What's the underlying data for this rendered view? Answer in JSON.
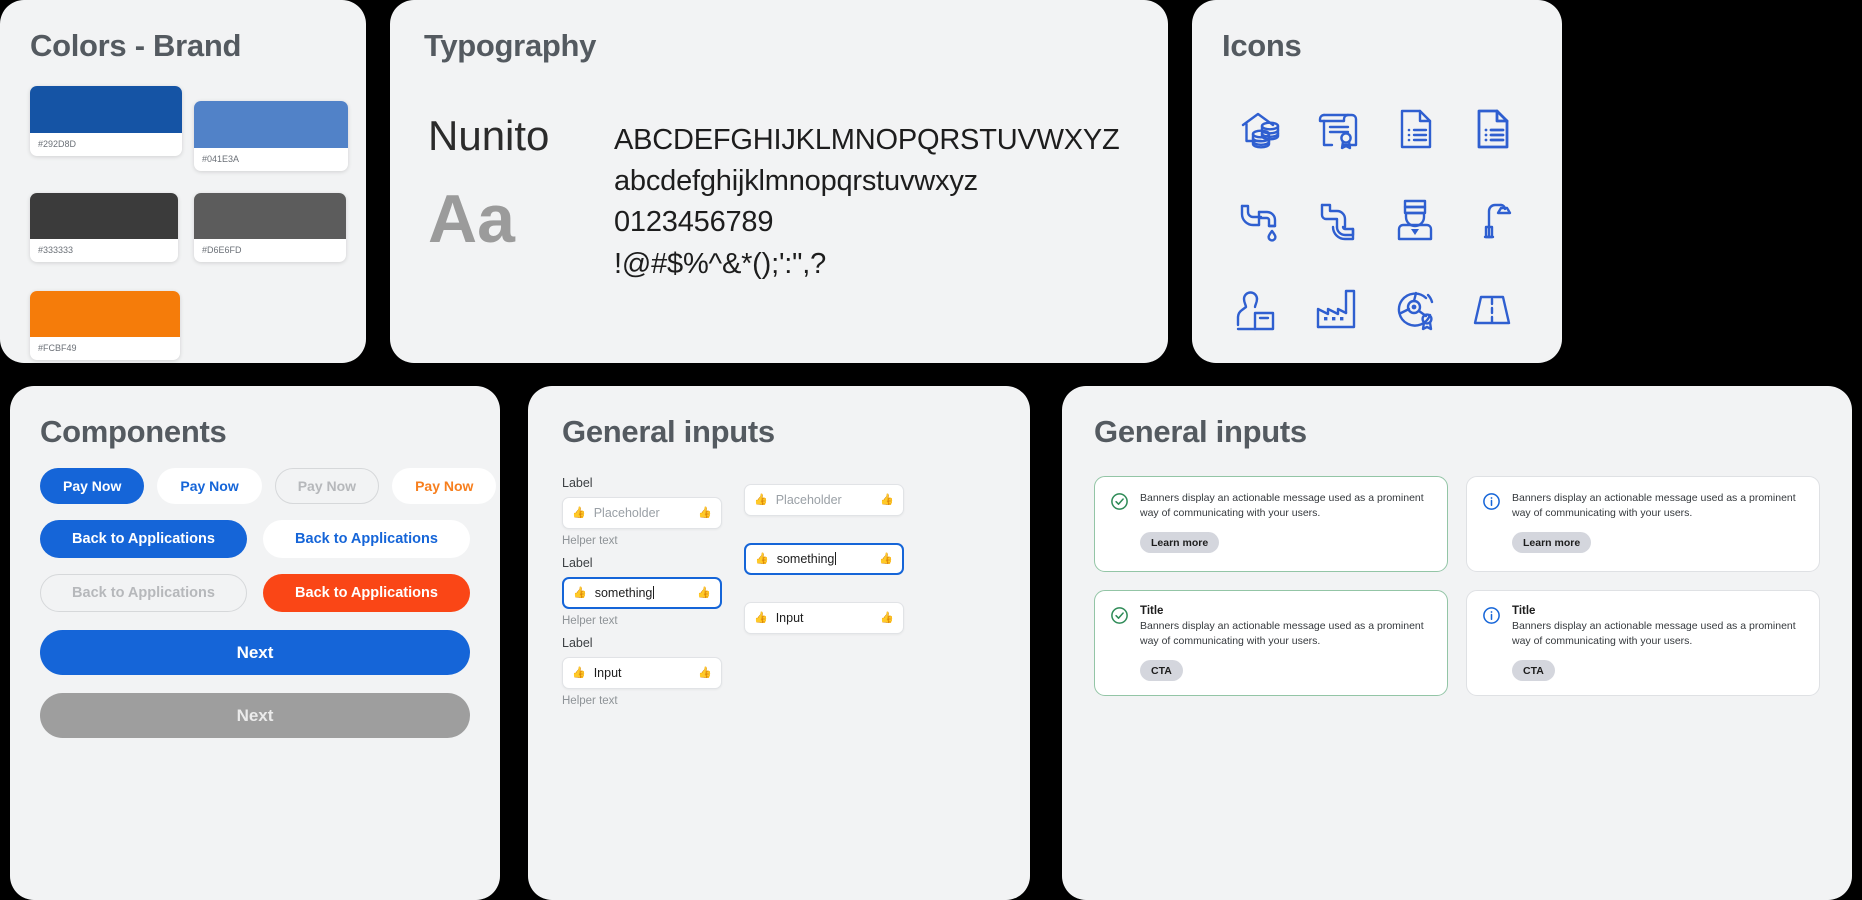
{
  "colors_panel": {
    "title": "Colors - Brand",
    "swatches": [
      {
        "hex_label": "#292D8D",
        "color": "#1554a5"
      },
      {
        "hex_label": "#041E3A",
        "color": "#5182c8"
      },
      {
        "hex_label": "#333333",
        "color": "#3b3b3b"
      },
      {
        "hex_label": "#D6E6FD",
        "color": "#5c5c5c"
      },
      {
        "hex_label": "#FCBF49",
        "color": "#f57c0a"
      }
    ]
  },
  "typography_panel": {
    "title": "Typography",
    "font_name": "Nunito",
    "sample_aa": "Aa",
    "lines": [
      "ABCDEFGHIJKLMNOPQRSTUVWXYZ",
      "abcdefghijklmnopqrstuvwxyz",
      "0123456789",
      "!@#$%^&*();':\",?"
    ]
  },
  "icons_panel": {
    "title": "Icons",
    "accent": "#2f5fd0",
    "icons": [
      {
        "name": "house-coins-icon"
      },
      {
        "name": "certificate-scroll-icon"
      },
      {
        "name": "document-list-icon"
      },
      {
        "name": "document-list-filled-icon"
      },
      {
        "name": "faucet-drip-icon"
      },
      {
        "name": "pipe-bend-icon"
      },
      {
        "name": "worker-helmet-icon"
      },
      {
        "name": "street-lamp-icon"
      },
      {
        "name": "person-package-icon"
      },
      {
        "name": "factory-icon"
      },
      {
        "name": "disc-award-icon"
      },
      {
        "name": "road-icon"
      }
    ]
  },
  "components_panel": {
    "title": "Components",
    "pay_buttons": [
      {
        "label": "Pay Now",
        "variant": "primary"
      },
      {
        "label": "Pay Now",
        "variant": "secondary"
      },
      {
        "label": "Pay Now",
        "variant": "disabled"
      },
      {
        "label": "Pay Now",
        "variant": "warn"
      }
    ],
    "wide_buttons": [
      {
        "label": "Back to Applications",
        "variant": "primary"
      },
      {
        "label": "Back to Applications",
        "variant": "secondary"
      },
      {
        "label": "Back to Applications",
        "variant": "disabled"
      },
      {
        "label": "Back to Applications",
        "variant": "orange"
      }
    ],
    "full_buttons": [
      {
        "label": "Next",
        "variant": "primary"
      },
      {
        "label": "Next",
        "variant": "grey"
      }
    ],
    "colors": {
      "primary": "#1565d8",
      "orange": "#fa4616",
      "grey": "#9e9e9e",
      "warn_text": "#f77f1e"
    }
  },
  "inputs_panel": {
    "title": "General inputs",
    "left_column": [
      {
        "label": "Label",
        "value": "",
        "placeholder": "Placeholder",
        "helper": "Helper text",
        "focused": false,
        "leading_icon": "thumbs-up-icon",
        "trailing_icon": "thumbs-up-icon"
      },
      {
        "label": "Label",
        "value": "something",
        "placeholder": "",
        "helper": "Helper text",
        "focused": true,
        "leading_icon": "thumbs-up-icon",
        "trailing_icon": "thumbs-up-icon"
      },
      {
        "label": "Label",
        "value": "Input",
        "placeholder": "",
        "helper": "Helper text",
        "focused": false,
        "leading_icon": "thumbs-up-icon",
        "trailing_icon": "thumbs-up-icon"
      }
    ],
    "right_column": [
      {
        "label": "",
        "value": "",
        "placeholder": "Placeholder",
        "helper": "",
        "focused": false,
        "leading_icon": "thumbs-up-icon",
        "trailing_icon": "thumbs-up-icon"
      },
      {
        "label": "",
        "value": "something",
        "placeholder": "",
        "helper": "",
        "focused": true,
        "leading_icon": "thumbs-up-icon",
        "trailing_icon": "thumbs-up-icon"
      },
      {
        "label": "",
        "value": "Input",
        "placeholder": "",
        "helper": "",
        "focused": false,
        "leading_icon": "thumbs-up-icon",
        "trailing_icon": "thumbs-up-icon"
      }
    ]
  },
  "banners_panel": {
    "title": "General inputs",
    "banners": [
      {
        "status": "success",
        "icon": "check-circle-icon",
        "title": "",
        "message": "Banners display an actionable message used as a prominent way of communicating with your users.",
        "cta": "Learn more"
      },
      {
        "status": "info",
        "icon": "info-circle-icon",
        "title": "",
        "message": "Banners display an actionable message used as a prominent way of communicating with your users.",
        "cta": "Learn more"
      },
      {
        "status": "success",
        "icon": "check-circle-icon",
        "title": "Title",
        "message": "Banners display an actionable message used as a prominent way of communicating with your users.",
        "cta": "CTA"
      },
      {
        "status": "info",
        "icon": "info-circle-icon",
        "title": "Title",
        "message": "Banners display an actionable message used as a prominent way of communicating with your users.",
        "cta": "CTA"
      }
    ],
    "colors": {
      "success": "#2e8b57",
      "info": "#1565d8"
    }
  }
}
